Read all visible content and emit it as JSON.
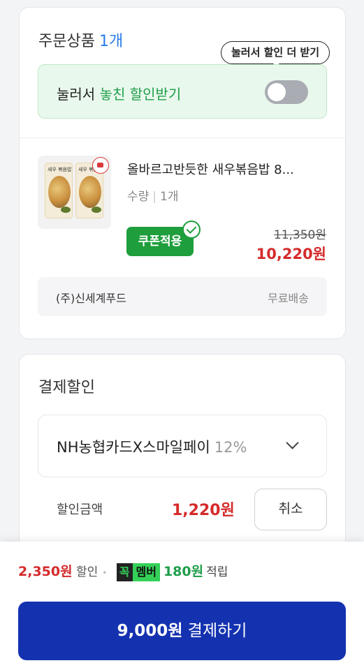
{
  "order": {
    "title": "주문상품",
    "count": "1개",
    "tooltip": "눌러서 할인 더 받기",
    "discount_prefix": "눌러서 ",
    "discount_highlight": "놓친 할인받기",
    "toggle_on": false,
    "product": {
      "name": "올바르고반듯한 새우볶음밥 8...",
      "qty_label": "수량",
      "qty_value": "1개",
      "coupon_label": "쿠폰적용",
      "original_price": "11,350원",
      "sale_price": "10,220원",
      "thumb_label_1": "새우 볶음밥",
      "thumb_label_2": "새우 볶음밥"
    },
    "seller": "(주)신세계푸드",
    "shipping": "무료배송"
  },
  "payment_discount": {
    "title": "결제할인",
    "card_name": "NH농협카드X스마일페이",
    "card_rate": "12%",
    "amount_label": "할인금액",
    "amount_value": "1,220원",
    "cancel_label": "취소"
  },
  "summary": {
    "discount_amount": "2,350원",
    "discount_text": "할인",
    "dot": "•",
    "badge_k": "꼭",
    "badge_m": "멤버",
    "reward_amount": "180원",
    "reward_text": "적립",
    "pay_amount": "9,000원",
    "pay_text": "결제하기"
  },
  "colors": {
    "primary_button": "#1432b0",
    "sale_red": "#d52b2b",
    "coupon_green": "#1e9e3c",
    "accent_blue": "#2b7de9"
  }
}
